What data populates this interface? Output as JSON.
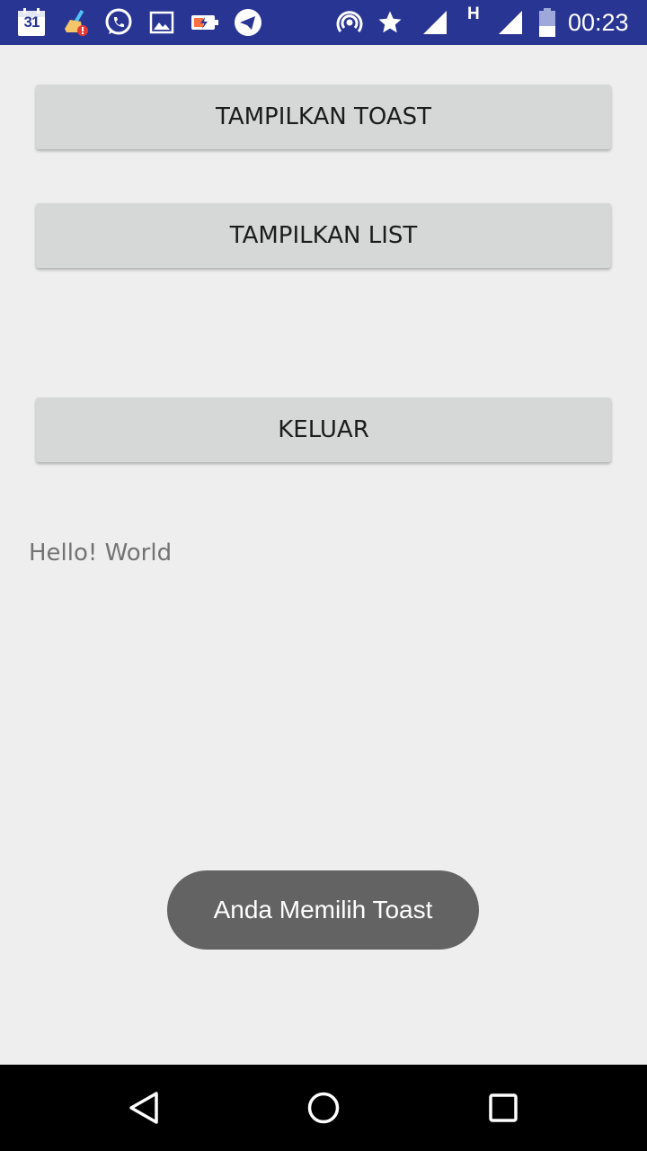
{
  "status_bar": {
    "calendar_day": "31",
    "network_type": "H",
    "time": "00:23",
    "notification_icons": [
      "calendar-icon",
      "cleaner-icon",
      "whatsapp-icon",
      "gallery-icon",
      "battery-saver-icon",
      "telegram-icon"
    ],
    "system_icons": [
      "hotspot-icon",
      "star-icon",
      "signal-icon",
      "signal-h-icon",
      "battery-icon"
    ],
    "background_color": "#283593"
  },
  "main": {
    "buttons": {
      "show_toast": "TAMPILKAN TOAST",
      "show_list": "TAMPILKAN LIST",
      "exit": "KELUAR"
    },
    "hello_text": "Hello! World"
  },
  "toast": {
    "message": "Anda Memilih Toast"
  },
  "nav_bar": {
    "buttons": [
      "back-icon",
      "home-icon",
      "recents-icon"
    ]
  }
}
